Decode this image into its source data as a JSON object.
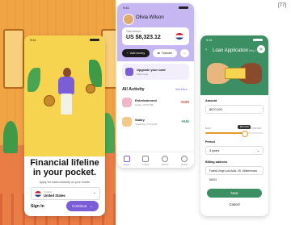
{
  "badge": "[77]",
  "onboarding": {
    "time": "9:41",
    "title_line1": "Financial lifeline",
    "title_line2": "in your pocket.",
    "subtitle": "Apply for loans instantly on your mobile",
    "country_label": "Country",
    "country_value": "United States",
    "sign_in": "Sign In",
    "continue": "Continue",
    "accent": "#7b5ed6"
  },
  "dashboard": {
    "time": "9:41",
    "user_name": "Olivia Wilson",
    "balance_label": "Total balance",
    "balance": "US $8,323.12",
    "add_money": "Add money",
    "transfer": "Transfer",
    "more": "···",
    "upgrade_title": "Upgrade your card",
    "upgrade_sub": "View more",
    "activity_title": "All Activity",
    "see_more": "See More",
    "transactions": [
      {
        "name": "Entertainment",
        "date": "Today, 10:00 PM",
        "amount": "-$180",
        "color": "#d94b4b"
      },
      {
        "name": "Salary",
        "date": "Yesterday, 07:12 AM",
        "amount": "+$4k",
        "color": "#3b8f62"
      }
    ],
    "nav": [
      "Home",
      "Loans",
      "History",
      "Profile"
    ]
  },
  "loan": {
    "time": "9:41",
    "back": "‹",
    "title": "Loan Application",
    "step": "Step 1",
    "close": "✕",
    "amount_label": "Amount",
    "amount_value": "$670,000",
    "slider_min": "$100",
    "slider_max": "$1,000,000",
    "slider_tip": "$670,000",
    "slider_fraction": 0.67,
    "period_label": "Period",
    "period_value": "3 years",
    "address_label": "Billing address",
    "address_value": "Fuenta Jorge Luis Avila, 1B, Villahermosa 84203",
    "next": "Next",
    "cancel": "Cancel",
    "accent": "#3b8f62"
  }
}
